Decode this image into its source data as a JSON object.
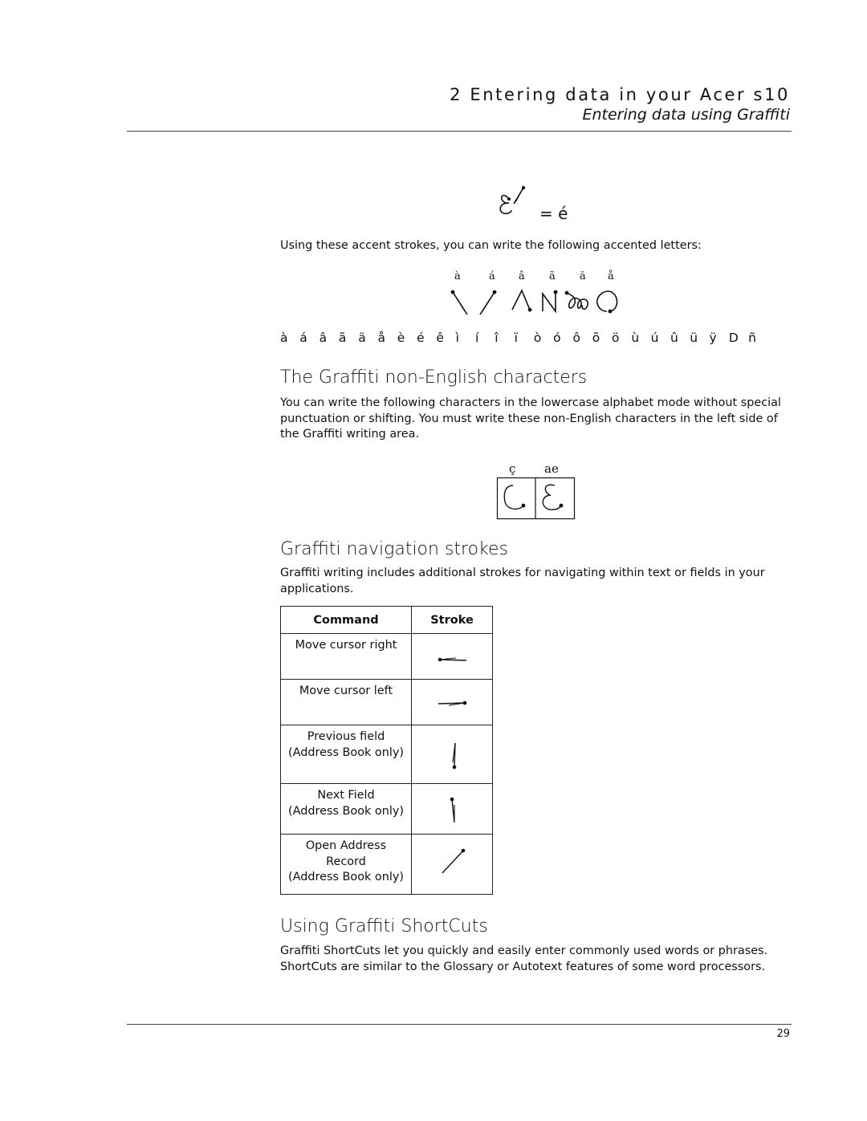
{
  "header": {
    "chapter": "2 Entering data in your Acer s10",
    "section": "Entering data using Graffiti"
  },
  "accent_example": {
    "equals_label": "= é",
    "caption": "Using these accent strokes, you can write the following accented letters:",
    "stroke_labels": [
      "à",
      "á",
      "â",
      "ã",
      "ä",
      "å"
    ],
    "stroke_icons": [
      "grave-accent-stroke-icon",
      "acute-accent-stroke-icon",
      "circumflex-stroke-icon",
      "tilde-stroke-icon",
      "umlaut-stroke-icon",
      "ring-stroke-icon"
    ],
    "accented_letters": [
      "à",
      "á",
      "â",
      "ã",
      "ä",
      "å",
      "è",
      "é",
      "ê",
      "ì",
      "í",
      "î",
      "ï",
      "ò",
      "ó",
      "ô",
      "õ",
      "ö",
      "ù",
      "ú",
      "û",
      "ü",
      "ÿ",
      "D",
      "ñ"
    ]
  },
  "non_english": {
    "heading": "The Graffiti non-English characters",
    "body": "You can write the following characters in the lowercase alphabet mode without special punctuation or shifting. You must write these non-English characters in the left side of the Graffiti writing area.",
    "chars": [
      {
        "label": "ç",
        "icon": "c-cedilla-stroke-icon"
      },
      {
        "label": "ae",
        "icon": "ae-stroke-icon"
      }
    ]
  },
  "navigation": {
    "heading": "Graffiti navigation strokes",
    "body": "Graffiti writing includes additional strokes for navigating within text or fields in your applications.",
    "table": {
      "headers": [
        "Command",
        "Stroke"
      ],
      "rows": [
        {
          "command": [
            "Move cursor right"
          ],
          "stroke_icon": "move-cursor-right-stroke-icon"
        },
        {
          "command": [
            "Move cursor left"
          ],
          "stroke_icon": "move-cursor-left-stroke-icon"
        },
        {
          "command": [
            "Previous field",
            "(Address Book only)"
          ],
          "stroke_icon": "previous-field-stroke-icon"
        },
        {
          "command": [
            "Next Field",
            "(Address Book only)"
          ],
          "stroke_icon": "next-field-stroke-icon"
        },
        {
          "command": [
            "Open Address",
            "Record",
            "(Address Book only)"
          ],
          "stroke_icon": "open-address-record-stroke-icon"
        }
      ]
    }
  },
  "shortcuts": {
    "heading": "Using Graffiti ShortCuts",
    "body_lines": [
      "Graffiti ShortCuts let you quickly and easily enter commonly used words or phrases.",
      "ShortCuts are similar to the Glossary or Autotext features of some word processors."
    ]
  },
  "footer": {
    "page_number": "29"
  }
}
